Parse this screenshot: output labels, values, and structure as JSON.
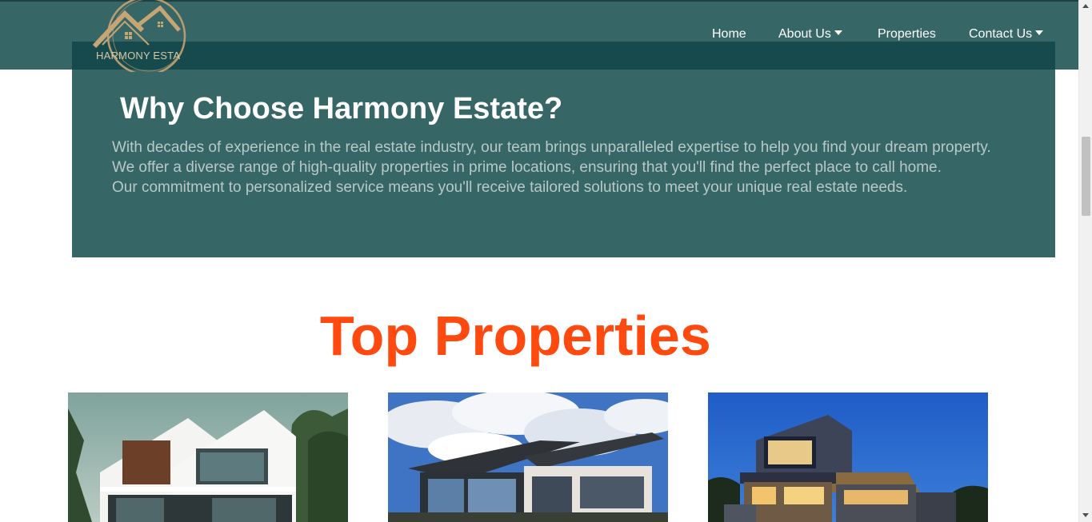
{
  "brand": {
    "logo_text": "HARMONY ESTA",
    "colors": {
      "header": "#376667",
      "accent": "#ff4a0f",
      "gold": "#c6a574"
    }
  },
  "nav": {
    "items": [
      {
        "label": "Home",
        "has_dropdown": false
      },
      {
        "label": "About Us",
        "has_dropdown": true
      },
      {
        "label": "Properties",
        "has_dropdown": false
      },
      {
        "label": "Contact Us",
        "has_dropdown": true
      }
    ]
  },
  "why": {
    "title": "Why Choose Harmony Estate?",
    "paragraphs": [
      "With decades of experience in the real estate industry, our team brings unparalleled expertise to help you find your dream property.",
      "We offer a diverse range of high-quality properties in prime locations, ensuring that you'll find the perfect place to call home.",
      "Our commitment to personalized service means you'll receive tailored solutions to meet your unique real estate needs."
    ]
  },
  "properties": {
    "title": "Top Properties",
    "cards": [
      {
        "image": "modern-white-villa-photo"
      },
      {
        "image": "modern-house-cloudy-sky-photo"
      },
      {
        "image": "modern-house-dusk-photo"
      }
    ]
  }
}
